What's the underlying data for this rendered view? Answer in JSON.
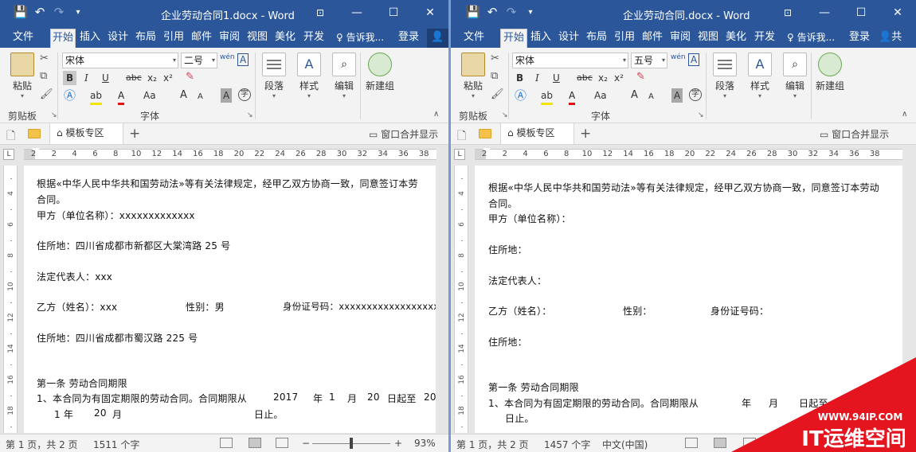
{
  "left": {
    "title": "企业劳动合同1.docx - Word",
    "tabs": [
      "文件",
      "开始",
      "插入",
      "设计",
      "布局",
      "引用",
      "邮件",
      "审阅",
      "视图",
      "美化",
      "开发"
    ],
    "active_tab": "开始",
    "tell_me": "告诉我...",
    "login": "登录",
    "font_name": "宋体",
    "font_size": "二号",
    "page_tab": "模板专区",
    "merge": "窗口合并显示",
    "doc_lines": [
      "根据«中华人民中华共和国劳动法»等有关法律规定，经甲乙双方协商一致，同意签订本劳",
      "合同。",
      "甲方（单位名称）：xxxxxxxxxxxxx",
      "住所地：四川省成都市新都区大棠湾路 25 号",
      "法定代表人：xxx",
      "乙方（姓名）：xxx",
      "性别：男",
      "身份证号码：xxxxxxxxxxxxxxxxxxx",
      "住所地：四川省成都市蜀汉路 225 号",
      "第一条   劳动合同期限",
      "1、本合同为有固定期限的劳动合同。合同期限从",
      "2017",
      "年",
      "1",
      "月",
      "20",
      "日起至",
      "20",
      "1 年",
      "20",
      "月",
      "日止。"
    ],
    "status_page": "第 1 页，共 2 页",
    "status_words": "1511 个字",
    "zoom": "93%",
    "zoom_level": 0.5
  },
  "right": {
    "title": "企业劳动合同.docx - Word",
    "tabs": [
      "文件",
      "开始",
      "插入",
      "设计",
      "布局",
      "引用",
      "邮件",
      "审阅",
      "视图",
      "美化",
      "开发"
    ],
    "active_tab": "开始",
    "tell_me": "告诉我...",
    "login": "登录",
    "share": "共",
    "font_name": "宋体",
    "font_size": "五号",
    "page_tab": "模板专区",
    "merge": "窗口合并显示",
    "doc_lines": [
      "根据«中华人民中华共和国劳动法»等有关法律规定，经甲乙双方协商一致，同意签订本劳动",
      "合同。",
      "甲方（单位名称）：",
      "住所地：",
      "法定代表人：",
      "乙方（姓名）：",
      "性别：",
      "身份证号码：",
      "住所地：",
      "第一条   劳动合同期限",
      "1、本合同为有固定期限的劳动合同。合同期限从",
      "年",
      "月",
      "日起至",
      "日止。"
    ],
    "status_page": "第 1 页，共 2 页",
    "status_words": "1457 个字",
    "language": "中文(中国)"
  },
  "ribbon": {
    "clipboard": "剪贴板",
    "paste": "粘贴",
    "font": "字体",
    "paragraph": "段落",
    "styles": "样式",
    "editing": "编辑",
    "new_group": "新建组",
    "bold": "B",
    "italic": "I",
    "underline": "U",
    "strike": "abc",
    "sub": "x₂",
    "sup": "x²",
    "case": "Aa",
    "grow": "A",
    "shrink": "A",
    "wen": "wén",
    "char_border": "A",
    "char_shade": "A",
    "enclose": "字"
  },
  "ruler_ticks": [
    "2",
    "2",
    "4",
    "6",
    "8",
    "10",
    "12",
    "14",
    "16",
    "18",
    "20",
    "22",
    "24",
    "26",
    "28",
    "30",
    "32",
    "34",
    "36",
    "38"
  ],
  "vruler_ticks": [
    "1",
    "4",
    "1",
    "6",
    "1",
    "8",
    "1",
    "10",
    "1",
    "12",
    "1",
    "14",
    "1",
    "16",
    "1",
    "18",
    "1"
  ],
  "watermark": {
    "url": "WWW.94IP.COM",
    "brand": "IT运维空间"
  }
}
